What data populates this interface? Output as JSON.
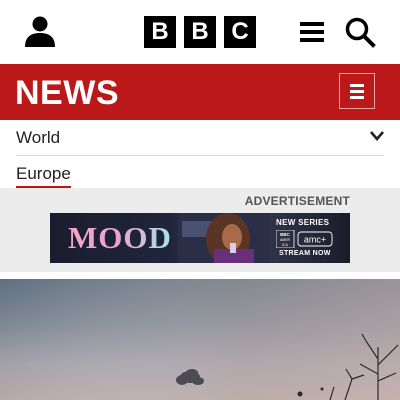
{
  "header": {
    "logo_letters": [
      "B",
      "B",
      "C"
    ],
    "icons": {
      "account": "account-icon",
      "menu": "menu-icon",
      "search": "search-icon"
    }
  },
  "news_bar": {
    "title": "NEWS",
    "menu_icon": "menu-icon",
    "background_color": "#bb1919"
  },
  "section_nav": {
    "current_section": "World",
    "expand_icon": "chevron-down-icon",
    "active_subsection": "Europe"
  },
  "advertisement": {
    "label": "ADVERTISEMENT",
    "headline": "MOOD",
    "tagline": "NEW SERIES",
    "logo_text": [
      "BBC",
      "AMERICA",
      "amc+"
    ],
    "cta": "STREAM NOW"
  },
  "hero_image": {
    "description_icon": "photo-image"
  }
}
